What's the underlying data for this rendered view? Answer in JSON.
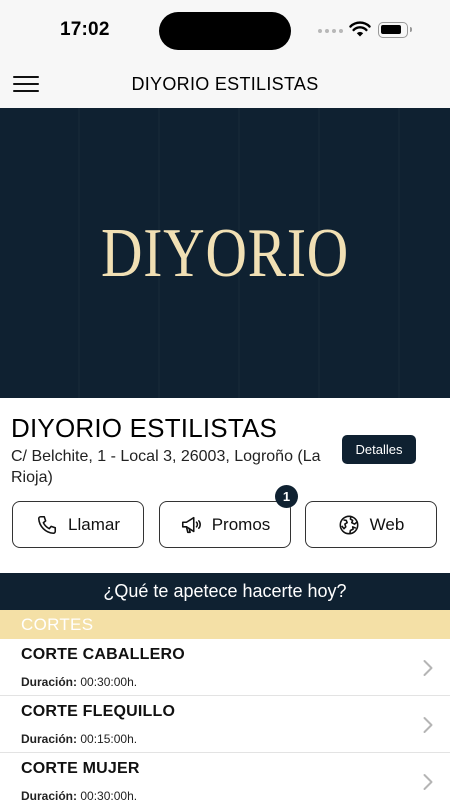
{
  "status_bar": {
    "time": "17:02",
    "icons": [
      "signal-icon",
      "wifi-icon",
      "battery-icon"
    ]
  },
  "nav": {
    "title": "DIYORIO ESTILISTAS",
    "menu_icon": "hamburger-menu-icon"
  },
  "hero": {
    "logo_text": "DIYORIO"
  },
  "business": {
    "name": "DIYORIO ESTILISTAS",
    "address": "C/ Belchite, 1 - Local 3, 26003, Logroño (La Rioja)",
    "details_label": "Detalles"
  },
  "actions": {
    "call": {
      "label": "Llamar",
      "icon": "phone-icon"
    },
    "promos": {
      "label": "Promos",
      "icon": "megaphone-icon",
      "badge": "1"
    },
    "web": {
      "label": "Web",
      "icon": "globe-icon"
    }
  },
  "services_section": {
    "question": "¿Qué te apetece hacerte hoy?",
    "category": "CORTES",
    "duration_label": "Duración:",
    "items": [
      {
        "name": "CORTE CABALLERO",
        "duration": "00:30:00h."
      },
      {
        "name": "CORTE FLEQUILLO",
        "duration": "00:15:00h."
      },
      {
        "name": "CORTE MUJER",
        "duration": "00:30:00h."
      }
    ]
  },
  "colors": {
    "brand_navy": "#0f2131",
    "logo_gold": "#f1e0b4",
    "category_yellow": "#f4e0a6",
    "nav_background": "#f7f7f7"
  }
}
